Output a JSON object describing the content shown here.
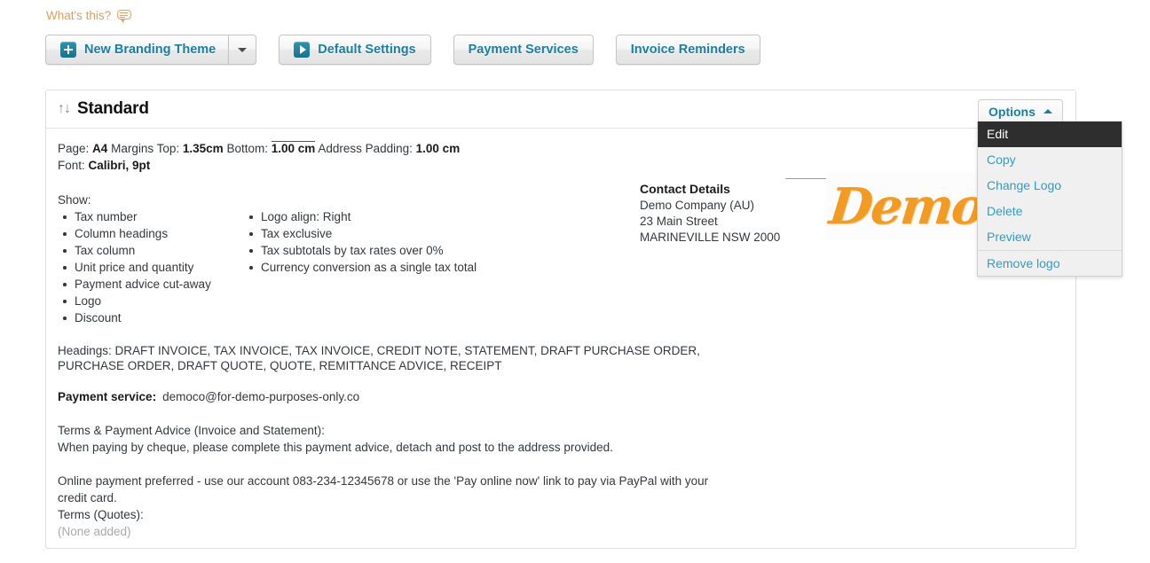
{
  "help": {
    "label": "What's this?",
    "icon": "speech-bubble-icon"
  },
  "toolbar": {
    "new_branding_theme": "New Branding Theme",
    "default_settings": "Default Settings",
    "payment_services": "Payment Services",
    "invoice_reminders": "Invoice Reminders",
    "accent_color": "#1a7fa0"
  },
  "panel": {
    "title": "Standard",
    "sort_icon": "↑↓",
    "options_button": "Options",
    "meta": {
      "page_label": "Page:",
      "page_value": "A4",
      "margins_label": "Margins Top:",
      "margins_top": "1.35cm",
      "bottom_label": "Bottom:",
      "bottom_value": "1.00 cm",
      "address_padding_label": "Address Padding:",
      "address_padding_value": "1.00 cm",
      "font_label": "Font:",
      "font_value": "Calibri, 9pt"
    },
    "show_label": "Show:",
    "show_left": [
      "Tax number",
      "Column headings",
      "Tax column",
      "Unit price and quantity",
      "Payment advice cut-away",
      "Logo",
      "Discount"
    ],
    "show_right": [
      "Logo align: Right",
      "Tax exclusive",
      "Tax subtotals by tax rates over 0%",
      "Currency conversion as a single tax total"
    ],
    "headings": "Headings: DRAFT INVOICE, TAX INVOICE, TAX INVOICE, CREDIT NOTE, STATEMENT, DRAFT PURCHASE ORDER, PURCHASE ORDER, DRAFT QUOTE, QUOTE, REMITTANCE ADVICE, RECEIPT",
    "payment_service_label": "Payment service:",
    "payment_service_value": "democo@for-demo-purposes-only.co",
    "terms_invoice_heading": "Terms & Payment Advice (Invoice and Statement):",
    "terms_invoice_line1": "When paying by cheque, please complete this payment advice, detach and post to the address provided.",
    "terms_invoice_line2": "Online payment preferred - use our account 083-234-12345678 or use the 'Pay online now' link to pay via PayPal with your credit card.",
    "terms_quotes_heading": "Terms (Quotes):",
    "terms_quotes_value": "(None added)"
  },
  "contact": {
    "title": "Contact Details",
    "company": "Demo Company (AU)",
    "street": "23 Main Street",
    "city": "MARINEVILLE NSW 2000"
  },
  "logo": {
    "text": "Demo",
    "color": "#f39a23"
  },
  "options_menu": {
    "items": [
      {
        "label": "Edit",
        "active": true
      },
      {
        "label": "Copy",
        "active": false
      },
      {
        "label": "Change Logo",
        "active": false
      },
      {
        "label": "Delete",
        "active": false
      },
      {
        "label": "Preview",
        "active": false
      },
      {
        "label": "Remove logo",
        "active": false
      }
    ]
  }
}
